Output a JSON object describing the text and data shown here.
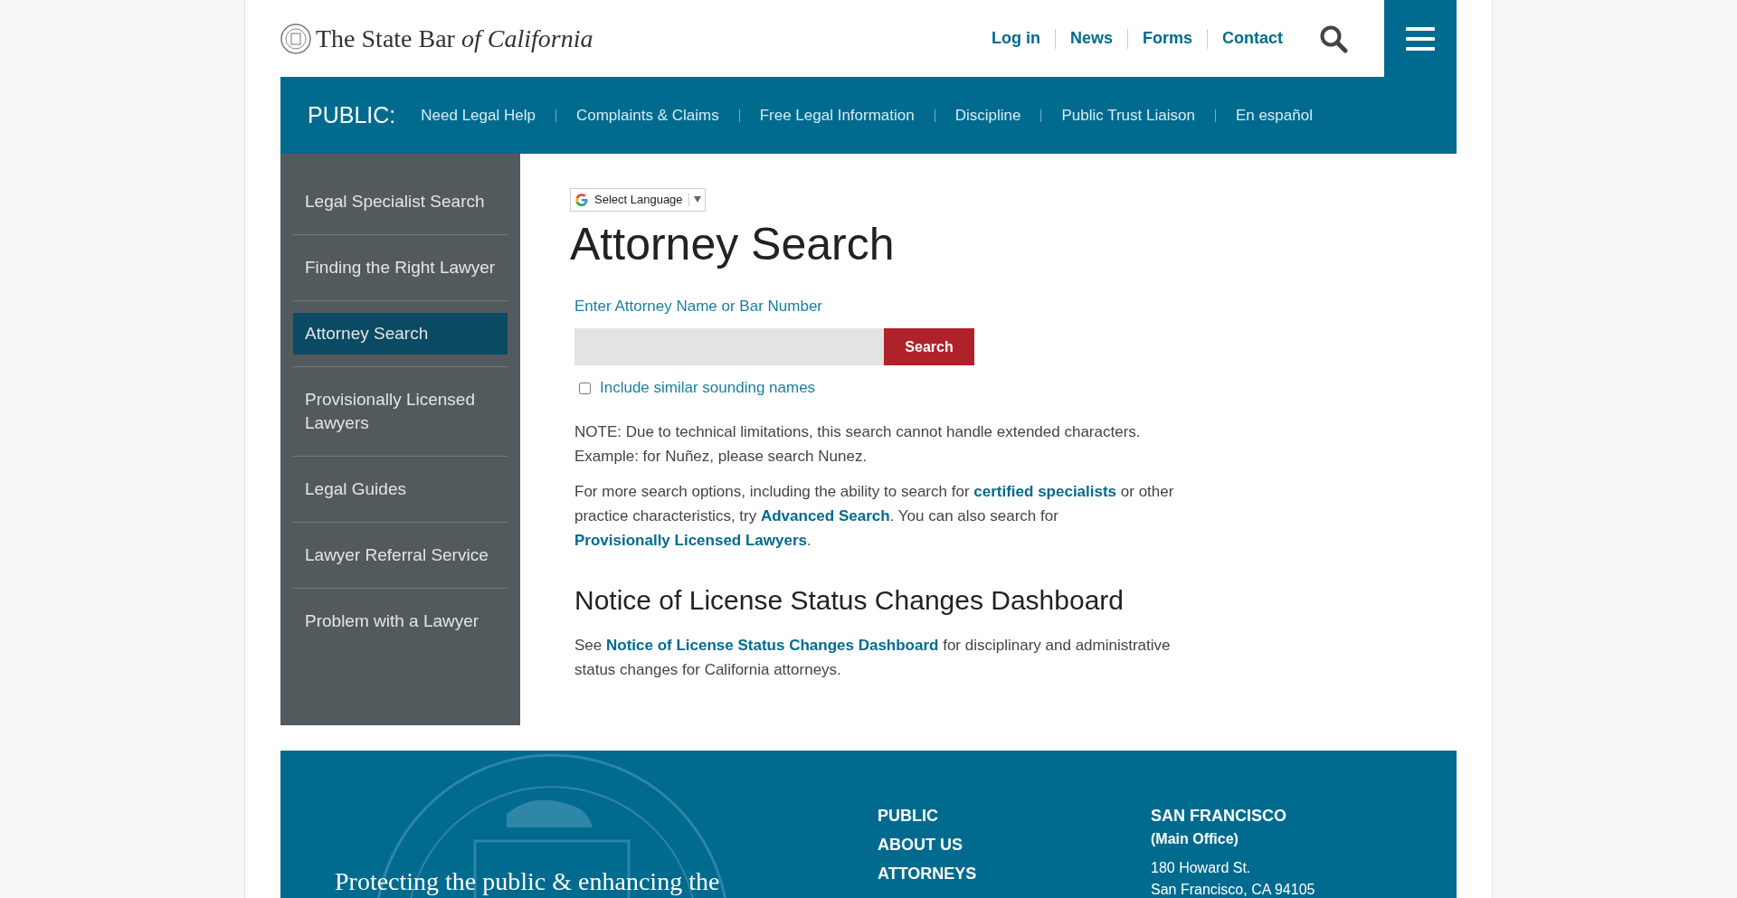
{
  "header": {
    "logo": "The State Bar *of California*",
    "nav": [
      "Log in",
      "News",
      "Forms",
      "Contact"
    ]
  },
  "public_bar": {
    "label": "PUBLIC:",
    "links": [
      "Need Legal Help",
      "Complaints & Claims",
      "Free Legal Information",
      "Discipline",
      "Public Trust Liaison",
      "En español"
    ]
  },
  "sidebar": {
    "items": [
      {
        "label": "Legal Specialist Search",
        "selected": false
      },
      {
        "label": "Finding the Right Lawyer",
        "selected": false
      },
      {
        "label": "Attorney Search",
        "selected": true
      },
      {
        "label": "Provisionally Licensed Lawyers",
        "selected": false
      },
      {
        "label": "Legal Guides",
        "selected": false
      },
      {
        "label": "Lawyer Referral Service",
        "selected": false
      },
      {
        "label": "Problem with a Lawyer",
        "selected": false
      }
    ]
  },
  "main": {
    "language_selector": "Select Language",
    "title": "Attorney Search",
    "search": {
      "label": "Enter Attorney Name or Bar Number",
      "button": "Search",
      "checkbox": {
        "label": "Include similar sounding names",
        "checked": false
      }
    },
    "paragraphs": [
      [
        {
          "text": "NOTE: Due to technical limitations, this search cannot handle extended characters. Example: for Nuñez, please search Nunez.",
          "link": false
        }
      ],
      [
        {
          "text": "For more search options, including the ability to search for ",
          "link": false
        },
        {
          "text": "certified specialists",
          "link": true
        },
        {
          "text": " or other practice characteristics, try ",
          "link": false
        },
        {
          "text": "Advanced Search",
          "link": true
        },
        {
          "text": ". You can also search for ",
          "link": false
        },
        {
          "text": "Provisionally Licensed Lawyers",
          "link": true
        },
        {
          "text": ".",
          "link": false
        }
      ]
    ],
    "section_title": "Notice of License Status Changes Dashboard",
    "section_paragraph": [
      {
        "text": "See ",
        "link": false
      },
      {
        "text": "Notice of License Status Changes Dashboard",
        "link": true
      },
      {
        "text": " for disciplinary and administrative status changes for California attorneys.",
        "link": false
      }
    ]
  },
  "footer": {
    "tagline": "Protecting the public & enhancing the",
    "links": [
      "PUBLIC",
      "ABOUT US",
      "ATTORNEYS"
    ],
    "office": {
      "city": "SAN FRANCISCO",
      "subtitle": "(Main Office)",
      "address": [
        "180 Howard St.",
        "San Francisco, CA 94105"
      ]
    }
  }
}
